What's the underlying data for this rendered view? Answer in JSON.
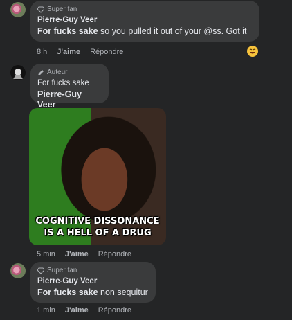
{
  "comments": [
    {
      "badge": "Super fan",
      "quote": "Pierre-Guy Veer",
      "text_bold": "For fucks sake",
      "text_rest": " so you pulled it out of your @ss. Got it",
      "time": "8 h",
      "like": "J'aime",
      "reply": "Répondre",
      "reaction": "laughing-emoji"
    },
    {
      "badge": "Auteur",
      "quote_line1": "For fucks sake",
      "quote_line2": "Pierre-Guy Veer",
      "gif_caption_1": "COGNITIVE DISSONANCE",
      "gif_caption_2": "IS A HELL OF A DRUG",
      "time": "5 min",
      "like": "J'aime",
      "reply": "Répondre"
    },
    {
      "badge": "Super fan",
      "quote": "Pierre-Guy Veer",
      "text_bold": "For fucks sake",
      "text_rest": " non sequitur",
      "time": "1 min",
      "like": "J'aime",
      "reply": "Répondre"
    }
  ],
  "colors": {
    "background": "#242526",
    "bubble": "#3a3b3c",
    "text": "#e4e6eb",
    "muted": "#b0b3b8"
  }
}
